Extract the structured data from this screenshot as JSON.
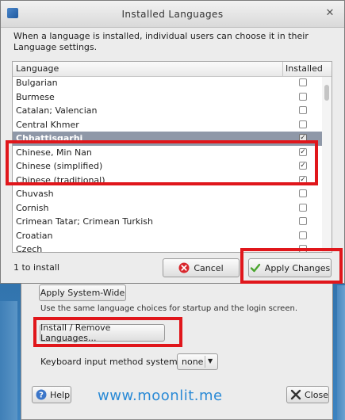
{
  "dialog": {
    "title": "Installed Languages",
    "intro": "When a language is installed, individual users can choose it in their Language settings.",
    "columns": {
      "language": "Language",
      "installed": "Installed"
    },
    "rows": [
      {
        "label": "Bulgarian",
        "installed": false
      },
      {
        "label": "Burmese",
        "installed": false
      },
      {
        "label": "Catalan; Valencian",
        "installed": false
      },
      {
        "label": "Central Khmer",
        "installed": false
      },
      {
        "label": "Chhattisgarhi",
        "installed": true,
        "selected": true
      },
      {
        "label": "Chinese, Min Nan",
        "installed": true
      },
      {
        "label": "Chinese (simplified)",
        "installed": true
      },
      {
        "label": "Chinese (traditional)",
        "installed": true
      },
      {
        "label": "Chuvash",
        "installed": false
      },
      {
        "label": "Cornish",
        "installed": false
      },
      {
        "label": "Crimean Tatar; Crimean Turkish",
        "installed": false
      },
      {
        "label": "Croatian",
        "installed": false
      },
      {
        "label": "Czech",
        "installed": false
      }
    ],
    "status": "1 to install",
    "cancel_label": "Cancel",
    "apply_label": "Apply Changes"
  },
  "back_window": {
    "apply_system_wide_label": "Apply System-Wide",
    "note": "Use the same language choices for startup and the login screen.",
    "install_remove_label": "Install / Remove Languages...",
    "keyboard_label": "Keyboard input method system:",
    "keyboard_value": "none",
    "help_label": "Help",
    "close_label": "Close"
  },
  "watermark": "www.moonlit.me",
  "colors": {
    "highlight": "#e0161b",
    "selected_row": "#8f98a8",
    "watermark": "#2a8ad6"
  }
}
